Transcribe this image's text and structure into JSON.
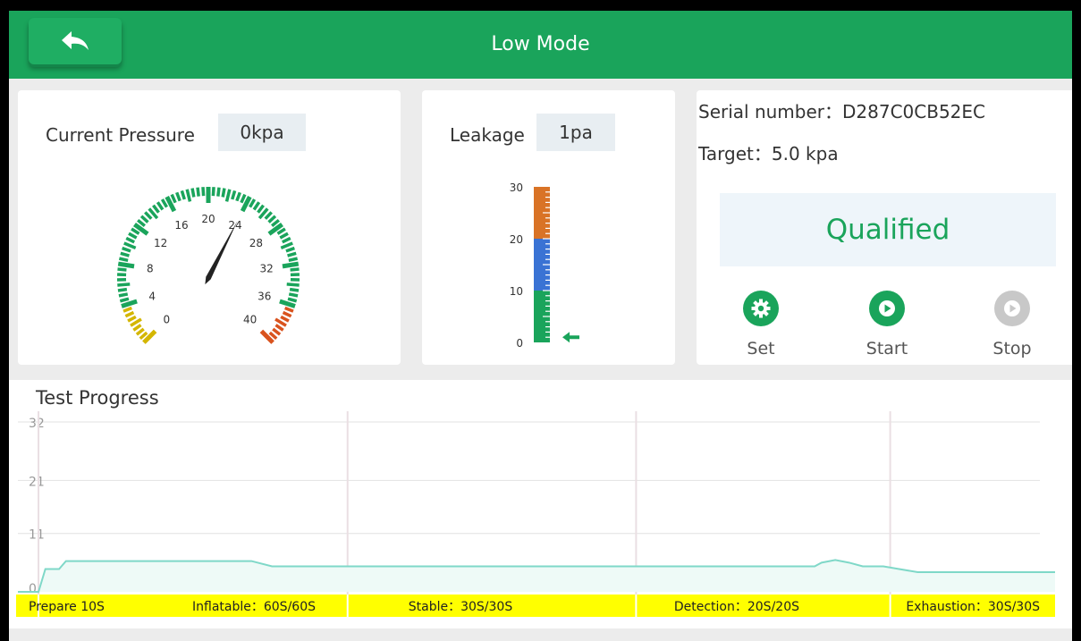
{
  "header": {
    "title": "Low Mode",
    "back_icon": "back-arrow-icon"
  },
  "pressure": {
    "label": "Current Pressure",
    "value": "0kpa",
    "gauge": {
      "ticks": [
        "0",
        "4",
        "8",
        "12",
        "16",
        "20",
        "24",
        "28",
        "32",
        "36",
        "40"
      ],
      "needle_value": 24,
      "colors": {
        "low": "#d4b600",
        "normal": "#1aa45b",
        "high": "#d9531e"
      }
    }
  },
  "leakage": {
    "label": "Leakage",
    "value": "1pa",
    "scale": [
      "0",
      "10",
      "20",
      "30"
    ],
    "current_value": 1,
    "colors": {
      "low": "#1aa45b",
      "mid": "#3a73d4",
      "high": "#d97326"
    }
  },
  "info": {
    "serial": "Serial number：D287C0CB52EC",
    "target": "Target：5.0 kpa",
    "result": "Qualified",
    "result_color": "#1aa45b"
  },
  "controls": [
    {
      "label": "Set",
      "icon": "gear-icon",
      "color": "#1aa45b"
    },
    {
      "label": "Start",
      "icon": "play-icon",
      "color": "#1aa45b"
    },
    {
      "label": "Stop",
      "icon": "play-icon",
      "color": "#c8c8c8"
    }
  ],
  "progress": {
    "title": "Test Progress",
    "stages": [
      {
        "label": "Prepare 10S"
      },
      {
        "label": "Inflatable：60S/60S"
      },
      {
        "label": "Stable：30S/30S"
      },
      {
        "label": "Detection：20S/20S"
      },
      {
        "label": "Exhaustion：30S/30S"
      }
    ],
    "stage_bar_color": "#ffff00",
    "line_color": "#7fd8c8"
  },
  "chart_data": {
    "type": "area",
    "title": "Test Progress",
    "yticks": [
      "32",
      "21",
      "11",
      "0"
    ],
    "ylim": [
      0,
      32
    ],
    "x": [
      0,
      3,
      4,
      6,
      7,
      19,
      34,
      37,
      38,
      50,
      100,
      101,
      116,
      117,
      119,
      121,
      123,
      124,
      126,
      131,
      151
    ],
    "values": [
      0,
      0,
      4.3,
      4.3,
      5.8,
      5.8,
      5.8,
      4.8,
      4.8,
      4.8,
      4.8,
      4.8,
      4.8,
      5.5,
      6.0,
      5.5,
      4.8,
      4.8,
      4.8,
      3.7,
      3.7
    ],
    "stage_boundaries_x": [
      3,
      48,
      90,
      127
    ]
  }
}
